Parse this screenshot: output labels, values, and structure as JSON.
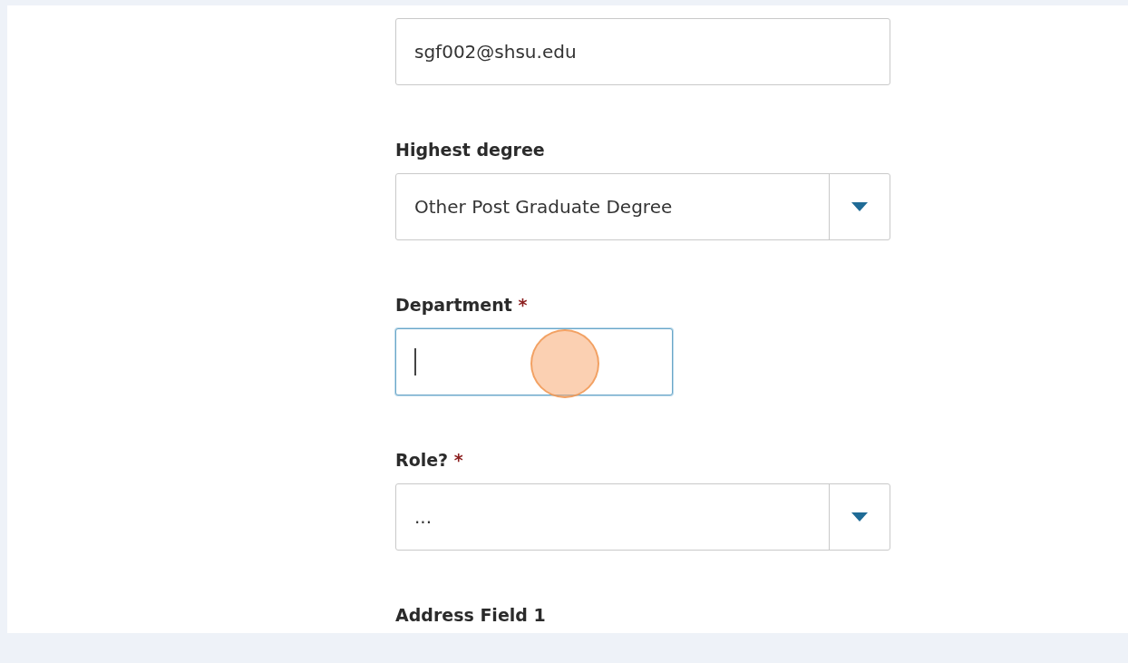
{
  "fields": [
    {
      "kind": "text",
      "value": "sgf002@shsu.edu",
      "focused": false
    },
    {
      "kind": "select",
      "label": "Highest degree",
      "required": false,
      "value": "Other Post Graduate Degree"
    },
    {
      "kind": "text",
      "label": "Department",
      "required": true,
      "focused": true,
      "narrow": true
    },
    {
      "kind": "select",
      "label": "Role?",
      "required": true,
      "value": "..."
    },
    {
      "kind": "heading",
      "label": "Address Field 1",
      "required": false
    }
  ],
  "required_mark": "*"
}
